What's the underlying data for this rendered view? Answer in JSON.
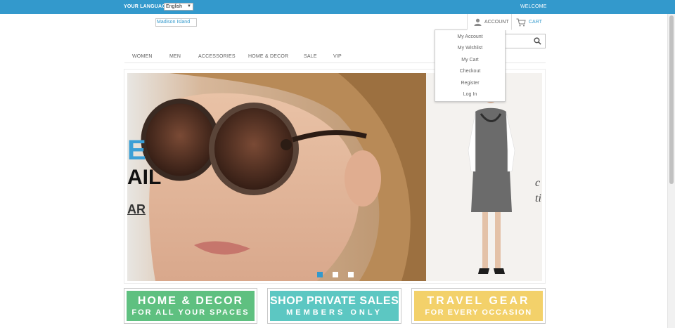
{
  "topbar": {
    "language_label": "YOUR LANGUAGE",
    "language_value": "English",
    "welcome": "WELCOME",
    "color": "#3399cc"
  },
  "header": {
    "logo_alt": "Madison Island",
    "account_label": "ACCOUNT",
    "account_icon": "user-icon",
    "cart_label": "CART",
    "cart_icon": "cart-icon",
    "search_placeholder": "",
    "search_icon": "search-icon"
  },
  "account_menu": {
    "items": [
      {
        "label": "My Account"
      },
      {
        "label": "My Wishlist"
      },
      {
        "label": "My Cart"
      },
      {
        "label": "Checkout"
      },
      {
        "label": "Register"
      },
      {
        "label": "Log In"
      }
    ]
  },
  "nav": {
    "items": [
      {
        "label": "WOMEN"
      },
      {
        "label": "MEN"
      },
      {
        "label": "ACCESSORIES"
      },
      {
        "label": "HOME & DECOR"
      },
      {
        "label": "SALE"
      },
      {
        "label": "VIP"
      }
    ]
  },
  "slider": {
    "main_text_1": "E",
    "main_text_2": "AIL",
    "main_text_3": "AR",
    "side_text_1": "c",
    "side_text_2": "ti",
    "dot_count": 3,
    "active_index": 0
  },
  "promos": [
    {
      "title": "HOME & DECOR",
      "subtitle": "FOR ALL YOUR SPACES",
      "color": "#5fc080"
    },
    {
      "title": "SHOP PRIVATE SALES",
      "subtitle": "MEMBERS ONLY",
      "color": "#5cc7c2"
    },
    {
      "title": "TRAVEL GEAR",
      "subtitle": "FOR EVERY OCCASION",
      "color": "#f3d16a"
    }
  ]
}
